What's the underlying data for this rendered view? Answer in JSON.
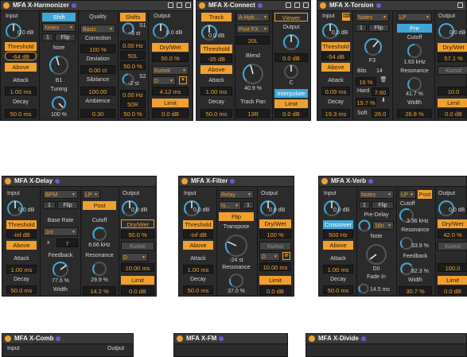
{
  "harmonizer": {
    "title": "MFA X-Harmonizer",
    "input_label": "Input",
    "input_value": "0.0 dB",
    "threshold_button": "Threshold",
    "threshold_value": "-64 dB",
    "above_button": "Above",
    "attack_label": "Attack",
    "attack_value": "1.00 ms",
    "decay_label": "Decay",
    "decay_value": "50.0 ms",
    "shift_tab": "Shift",
    "notes_select": "Notes",
    "notes_number": "1",
    "flip_button": "Flip",
    "note_label": "Note",
    "note_value": "B1",
    "tuning_label": "Tuning",
    "tuning_value": "100 %",
    "quality_label": "Quality",
    "quality_select": "Basic",
    "correction_label": "Correction",
    "correction_value": "100 %",
    "deviation_label": "Deviation",
    "deviation_value": "0.00 ct",
    "sibilance_label": "Sibilance",
    "sibilance_value": "100.00",
    "ambience_label": "Ambience",
    "ambience_value": "0.30",
    "shifts_tab": "Shifts",
    "s1_label": "S1",
    "s1_amount": "+8 st",
    "s1_freq": "0.00 Hz",
    "s1_pan": "50L",
    "s1_mix": "50.0 %",
    "s2_label": "S2",
    "s2_amount": "-2 st",
    "s2_freq": "0.00 Hz",
    "s2_pan": "50R",
    "s2_mix": "50.0 %",
    "output_label": "Output",
    "output_value": "0.0 dB",
    "drywet_button": "Dry/Wet",
    "drywet_value": "50.0 %",
    "filter_select": "Kumol",
    "mode_select": "D",
    "time_value": "4.12 ms",
    "limit_button": "Limit",
    "limit_value": "0.0 dB"
  },
  "connect": {
    "title": "MFA X-Connect",
    "track_button": "Track",
    "input_value": "0.0 dB",
    "threshold_button": "Threshold",
    "threshold_value": "-35 dB",
    "above_button": "Above",
    "attack_label": "Attack",
    "attack_value": "1.00 ms",
    "decay_label": "Decay",
    "decay_value": "50.0 ms",
    "source_select": "A-Hyb…",
    "fx_select": "Post FX",
    "fx_value": "20L",
    "blend_label": "Blend",
    "blend_value": "40.9 %",
    "trackpan_label": "Track Pan",
    "trackpan_value": "13R",
    "viewer_button": "Viewer",
    "output_label": "Output",
    "output_value": "0.0 dB",
    "c_label": "C",
    "interpolate_button": "Interpolate",
    "limit_button": "Limit",
    "limit_value": "0.0 dB"
  },
  "torsion": {
    "title": "MFA X-Torsion",
    "input_label": "Input",
    "input_value": "0.0 dB",
    "threshold_button": "Threshold",
    "threshold_value": "-54 dB",
    "above_button": "Above",
    "attack_label": "Attack",
    "attack_value": "0.09 ms",
    "decay_label": "Decay",
    "decay_value": "19.3 ms",
    "notes_select": "Notes",
    "notes_number": "1",
    "flip_button": "Flip",
    "note_value": "F3",
    "bits_label": "Bits",
    "bits_value": "14",
    "pct_value": "16 %",
    "hard_label": "Hard",
    "hard_value": "7.60",
    "soft_pct": "19.7 %",
    "soft_label": "Soft",
    "soft_value": "26.0",
    "filter_select": "LP",
    "pre_button": "Pre",
    "cutoff_label": "Cutoff",
    "cutoff_value": "1.63 kHz",
    "resonance_label": "Resonance",
    "resonance_value": "41.7 %",
    "width_label": "Width",
    "width_value": "26.8 %",
    "output_label": "Output",
    "output_value": "0.0 dB",
    "drywet_button": "Dry/Wet",
    "drywet_value": "57.1 %",
    "kumol_select": "Kumol",
    "time_value": "10.0",
    "limit_button": "Limit",
    "limit_value": "0.0 dB"
  },
  "delay": {
    "title": "MFA X-Delay",
    "input_label": "Input",
    "input_value": "0.0 dB",
    "threshold_button": "Threshold",
    "threshold_value": "-inf dB",
    "above_button": "Above",
    "attack_label": "Attack",
    "attack_value": "1.00 ms",
    "decay_label": "Decay",
    "decay_value": "50.0 ms",
    "bpm_select": "BPM",
    "number": "1",
    "flip_button": "Flip",
    "baserate_label": "Base Rate",
    "rate_select": "1nt",
    "mult_label": "x",
    "mult_value": "7",
    "feedback_label": "Feedback",
    "feedback_value": "77.6 %",
    "filter_select": "LP",
    "post_button": "Post",
    "cutoff_label": "Cutoff",
    "cutoff_value": "6.66 kHz",
    "resonance_label": "Resonance",
    "resonance_value": "29.9 %",
    "width_label": "Width",
    "width_value": "14.2 %",
    "output_label": "Output",
    "output_value": "0.0 dB",
    "drywet_button": "Dry/Wet",
    "drywet_value": "50.0 %",
    "kumoi_select": "Kumoi",
    "mode_select": "D",
    "time_value": "10.00 ms",
    "limit_button": "Limit",
    "limit_value": "0.0 dB"
  },
  "filter": {
    "title": "MFA X-Filter",
    "input_label": "Input",
    "input_value": "0.0 dB",
    "threshold_button": "Threshold",
    "threshold_value": "-inf dB",
    "above_button": "Above",
    "attack_label": "Attack",
    "attack_value": "1.00 ms",
    "decay_label": "Decay",
    "decay_value": "50.0 ms",
    "relay_select": "Relay",
    "n_select": "N…",
    "number": "1",
    "flip_button": "Flip",
    "transpose_label": "Transpose",
    "transpose_value": "-24 st",
    "resonance_label": "Resonance",
    "resonance_value": "37.0 %",
    "output_label": "Output",
    "output_value": "0.0 dB",
    "drywet_button": "Dry/Wet",
    "drywet_value": "100 %",
    "kumoi_select": "Kumoi",
    "mode_select": "D",
    "time_value": "10.00 ms",
    "limit_button": "Limit",
    "limit_value": "0.0 dB"
  },
  "verb": {
    "title": "MFA X-Verb",
    "input_label": "Input",
    "input_value": "0.0 dB",
    "crossover_button": "Crossover",
    "crossover_value": "500 Hz",
    "above_button": "Above",
    "attack_label": "Attack",
    "attack_value": "1.00 ms",
    "decay_label": "Decay",
    "decay_value": "50.0 ms",
    "notes_select": "Notes",
    "number": "1",
    "flip_button": "Flip",
    "predelay_label": "Pre-Delay",
    "predelay_value": "16n",
    "note_label": "Note",
    "note_value": "D0",
    "fadein_label": "Fade In",
    "fadein_value": "14.5 ms",
    "filter_select": "LP",
    "post_button": "Post",
    "cutoff_label": "Cutoff",
    "cutoff_value": "3.36 kHz",
    "resonance_label": "Resonance",
    "resonance_value": "33.9 %",
    "feedback_label": "Feedback",
    "feedback_value": "82.3 %",
    "width_label": "Width",
    "width_value": "30.7 %",
    "output_label": "Output",
    "output_value": "0.0 dB",
    "drywet_button": "Dry/Wet",
    "drywet_value": "42.0 %",
    "kumol_select": "Kumol",
    "time_value": "100.0",
    "limit_button": "Limit",
    "limit_value": "0.0 dB"
  },
  "bottom": {
    "comb_title": "MFA X-Comb",
    "comb_input": "Input",
    "comb_output": "Output",
    "fm_title": "MFA X-FM",
    "divide_title": "MFA X-Divide"
  }
}
